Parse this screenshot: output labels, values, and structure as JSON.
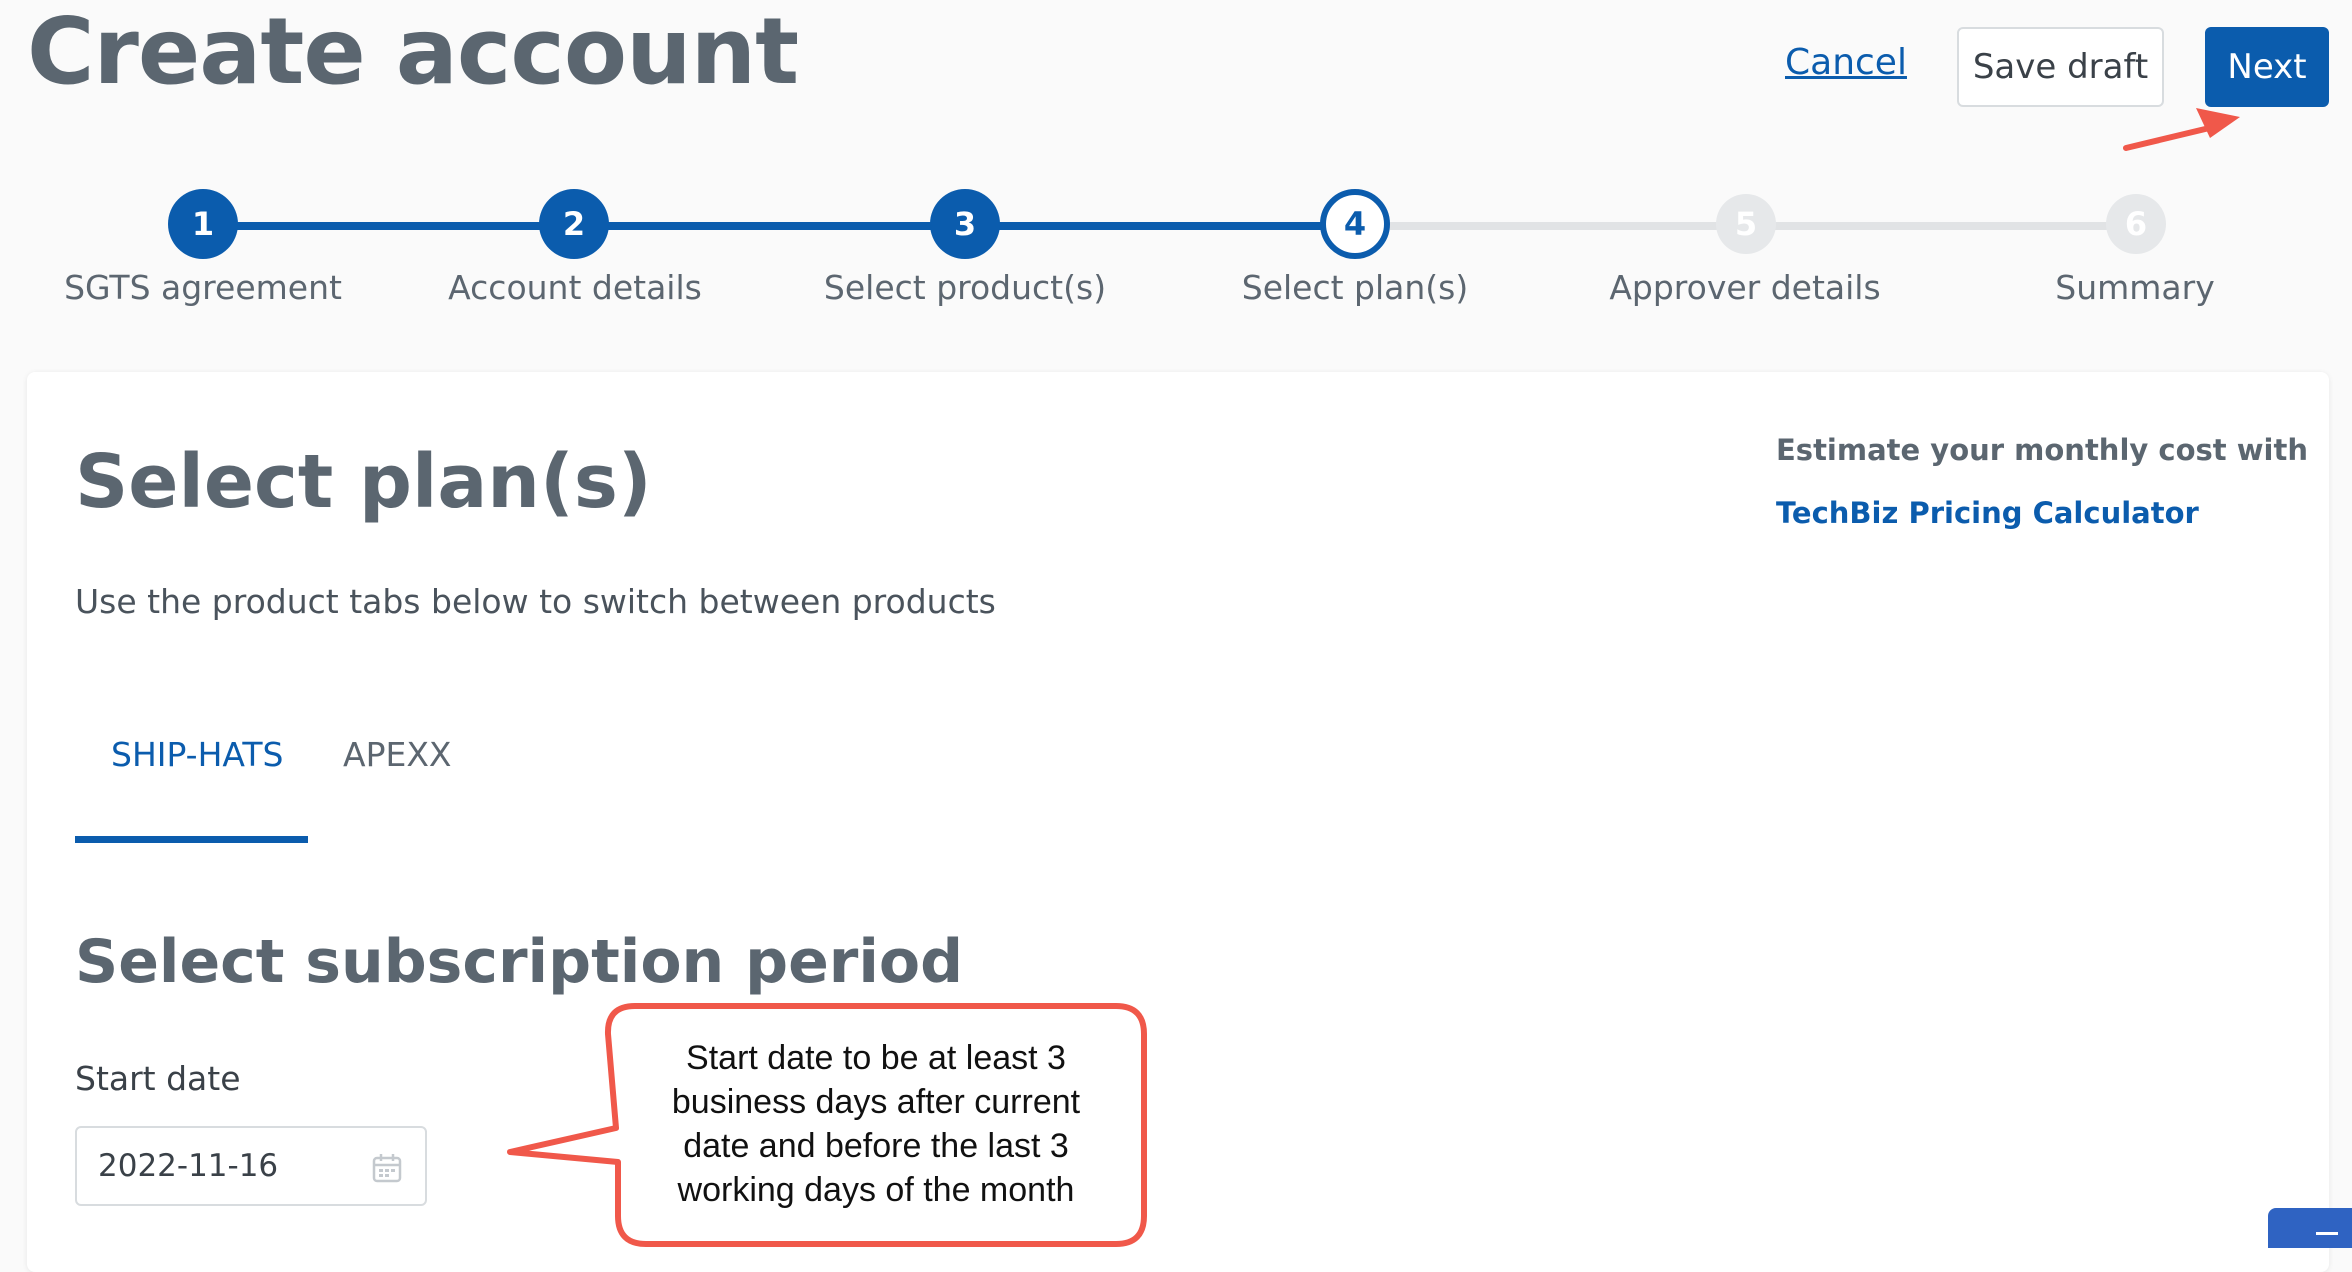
{
  "header": {
    "title": "Create account",
    "cancel_label": "Cancel",
    "save_draft_label": "Save draft",
    "next_label": "Next"
  },
  "stepper": {
    "current_step": 4,
    "steps": [
      {
        "number": "1",
        "label": "SGTS agreement",
        "state": "done"
      },
      {
        "number": "2",
        "label": "Account details",
        "state": "done"
      },
      {
        "number": "3",
        "label": "Select product(s)",
        "state": "done"
      },
      {
        "number": "4",
        "label": "Select plan(s)",
        "state": "current"
      },
      {
        "number": "5",
        "label": "Approver details",
        "state": "todo"
      },
      {
        "number": "6",
        "label": "Summary",
        "state": "todo"
      }
    ]
  },
  "main": {
    "title": "Select plan(s)",
    "subtitle": "Use the product tabs below to switch between products",
    "estimate_text": "Estimate your monthly cost with",
    "pricing_link": "TechBiz Pricing Calculator",
    "tabs": [
      {
        "label": "SHIP-HATS",
        "active": true
      },
      {
        "label": "APEXX",
        "active": false
      }
    ],
    "period_title": "Select subscription period",
    "start_date": {
      "label": "Start date",
      "value": "2022-11-16",
      "icon": "calendar-icon"
    }
  },
  "annotation": {
    "callout_lines": [
      "Start date to be at least 3",
      "business days after current",
      "date and before the last 3",
      "working days of the month"
    ],
    "color": "#f0584a"
  },
  "colors": {
    "primary": "#0b5cad",
    "heading": "#5b6670",
    "inactive_step": "#e1e3e5"
  }
}
